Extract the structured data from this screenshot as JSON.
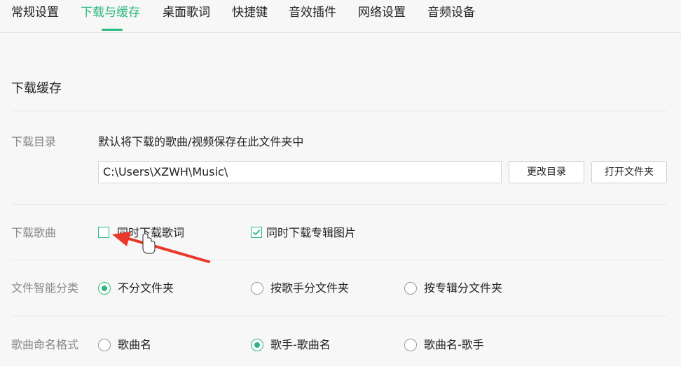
{
  "tabs": [
    {
      "label": "常规设置",
      "active": false
    },
    {
      "label": "下载与缓存",
      "active": true
    },
    {
      "label": "桌面歌词",
      "active": false
    },
    {
      "label": "快捷键",
      "active": false
    },
    {
      "label": "音效插件",
      "active": false
    },
    {
      "label": "网络设置",
      "active": false
    },
    {
      "label": "音频设备",
      "active": false
    }
  ],
  "section": {
    "title": "下载缓存"
  },
  "download_dir": {
    "label": "下载目录",
    "description": "默认将下载的歌曲/视频保存在此文件夹中",
    "path": "C:\\Users\\XZWH\\Music\\",
    "change_button": "更改目录",
    "open_button": "打开文件夹"
  },
  "download_songs": {
    "label": "下载歌曲",
    "option_lyrics": {
      "label": "同时下载歌词",
      "checked": false
    },
    "option_album_art": {
      "label": "同时下载专辑图片",
      "checked": true
    }
  },
  "file_classification": {
    "label": "文件智能分类",
    "options": [
      {
        "label": "不分文件夹",
        "selected": true
      },
      {
        "label": "按歌手分文件夹",
        "selected": false
      },
      {
        "label": "按专辑分文件夹",
        "selected": false
      }
    ]
  },
  "naming_format": {
    "label": "歌曲命名格式",
    "options": [
      {
        "label": "歌曲名",
        "selected": false
      },
      {
        "label": "歌手-歌曲名",
        "selected": true
      },
      {
        "label": "歌曲名-歌手",
        "selected": false
      }
    ]
  },
  "colors": {
    "accent": "#2cb97f",
    "annotation_arrow": "#e8392b"
  }
}
